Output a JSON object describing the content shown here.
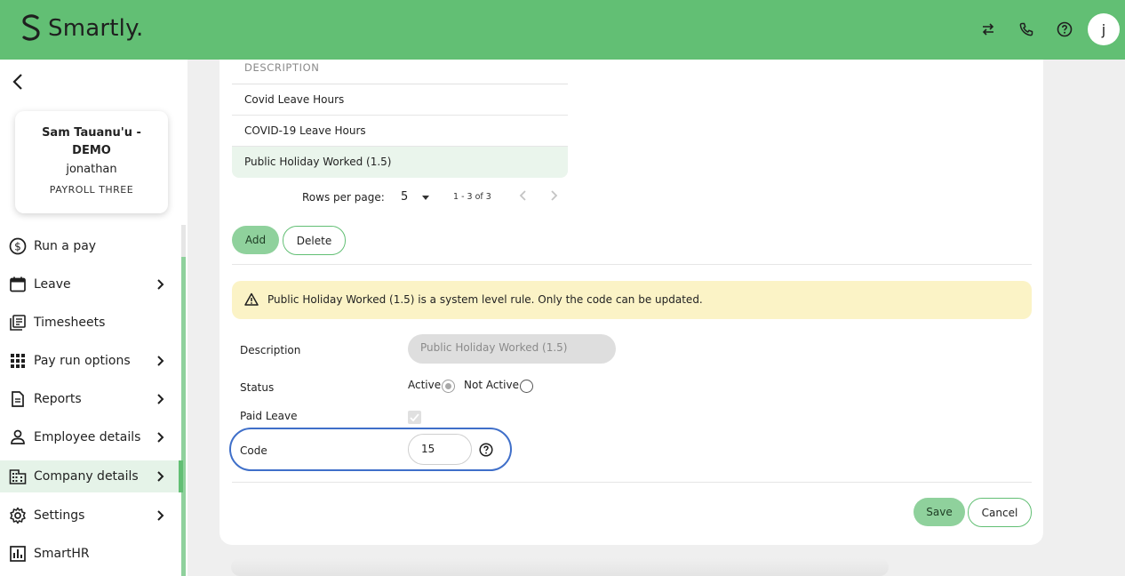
{
  "header": {
    "brand": "Smartly.",
    "icons": [
      "swap-icon",
      "phone-icon",
      "help-icon"
    ],
    "avatar_initial": "j",
    "bg_color": "#62bf74"
  },
  "sidebar": {
    "profile": {
      "name": "Sam Tauanu'u - DEMO",
      "username": "jonathan",
      "company": "PAYROLL THREE"
    },
    "items": [
      {
        "label": "Run a pay",
        "icon": "dollar-icon",
        "has_chevron": false,
        "active": false
      },
      {
        "label": "Leave",
        "icon": "calendar-icon",
        "has_chevron": true,
        "active": false
      },
      {
        "label": "Timesheets",
        "icon": "timesheets-icon",
        "has_chevron": false,
        "active": false
      },
      {
        "label": "Pay run options",
        "icon": "grid-icon",
        "has_chevron": true,
        "active": false
      },
      {
        "label": "Reports",
        "icon": "document-icon",
        "has_chevron": true,
        "active": false
      },
      {
        "label": "Employee details",
        "icon": "person-icon",
        "has_chevron": true,
        "active": false
      },
      {
        "label": "Company details",
        "icon": "building-icon",
        "has_chevron": true,
        "active": true
      },
      {
        "label": "Settings",
        "icon": "gear-icon",
        "has_chevron": true,
        "active": false
      },
      {
        "label": "SmartHR",
        "icon": "chart-icon",
        "has_chevron": false,
        "active": false
      }
    ]
  },
  "table": {
    "header": "DESCRIPTION",
    "rows": [
      "Covid Leave Hours",
      "COVID-19 Leave Hours",
      "Public Holiday Worked (1.5)"
    ],
    "selected_row": 2,
    "pagination": {
      "rows_per_page_label": "Rows per page:",
      "rows_per_page_value": "5",
      "range": "1 - 3 of 3"
    }
  },
  "actions": {
    "add_label": "Add",
    "delete_label": "Delete"
  },
  "alert": {
    "text": "Public Holiday Worked (1.5) is a system level rule. Only the code can be updated.",
    "color": "#fbf3c6"
  },
  "form": {
    "description_label": "Description",
    "description_value": "Public Holiday Worked (1.5)",
    "status_label": "Status",
    "status_active_label": "Active",
    "status_inactive_label": "Not Active",
    "status_value": "Active",
    "paid_leave_label": "Paid Leave",
    "paid_leave_checked": true,
    "code_label": "Code",
    "code_value": "15"
  },
  "footer": {
    "save_label": "Save",
    "cancel_label": "Cancel"
  }
}
